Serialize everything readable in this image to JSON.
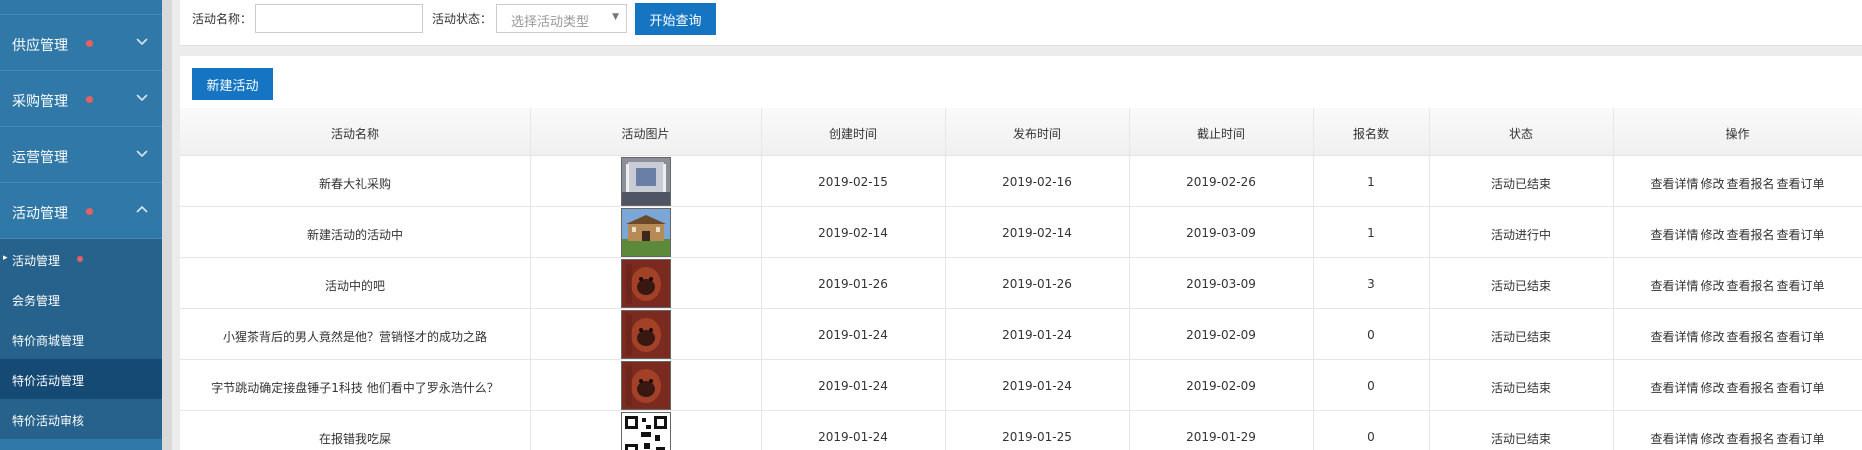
{
  "sidebar": {
    "groups": [
      {
        "label": "供应管理"
      },
      {
        "label": "采购管理"
      },
      {
        "label": "运营管理"
      },
      {
        "label": "活动管理"
      }
    ],
    "sub_items": [
      {
        "label": "活动管理"
      },
      {
        "label": "会务管理"
      },
      {
        "label": "特价商城管理"
      },
      {
        "label": "特价活动管理"
      },
      {
        "label": "特价活动审核"
      }
    ]
  },
  "search": {
    "name_label": "活动名称：",
    "name_value": "",
    "status_label": "活动状态：",
    "status_placeholder": "选择活动类型",
    "query_button": "开始查询"
  },
  "toolbar": {
    "new_button": "新建活动"
  },
  "table": {
    "headers": [
      "活动名称",
      "活动图片",
      "创建时间",
      "发布时间",
      "截止时间",
      "报名数",
      "状态",
      "操作"
    ],
    "actions": [
      "查看详情",
      "修改",
      "查看报名",
      "查看订单"
    ],
    "rows": [
      {
        "name": "新春大礼采购",
        "image": "hall-photo",
        "created": "2019-02-15",
        "published": "2019-02-16",
        "deadline": "2019-02-26",
        "signups": "1",
        "status": "活动已结束"
      },
      {
        "name": "新建活动的活动中",
        "image": "building-photo",
        "created": "2019-02-14",
        "published": "2019-02-14",
        "deadline": "2019-03-09",
        "signups": "1",
        "status": "活动进行中"
      },
      {
        "name": "活动中的吧",
        "image": "orangutan-photo",
        "created": "2019-01-26",
        "published": "2019-01-26",
        "deadline": "2019-03-09",
        "signups": "3",
        "status": "活动已结束"
      },
      {
        "name": "小猩茶背后的男人竟然是他？营销怪才的成功之路",
        "image": "orangutan-photo",
        "created": "2019-01-24",
        "published": "2019-01-24",
        "deadline": "2019-02-09",
        "signups": "0",
        "status": "活动已结束"
      },
      {
        "name": "字节跳动确定接盘锤子1科技 他们看中了罗永浩什么？",
        "image": "orangutan-photo",
        "created": "2019-01-24",
        "published": "2019-01-24",
        "deadline": "2019-02-09",
        "signups": "0",
        "status": "活动已结束"
      },
      {
        "name": "在报错我吃屎",
        "image": "qr-code",
        "created": "2019-01-24",
        "published": "2019-01-25",
        "deadline": "2019-01-29",
        "signups": "0",
        "status": "活动已结束"
      }
    ]
  },
  "colors": {
    "sidebar_bg": "#2f78a7",
    "sidebar_sub_bg": "#26628c",
    "sidebar_active_bg": "#154a75",
    "accent_button": "#1575c3",
    "dot_red": "#e8605f"
  }
}
